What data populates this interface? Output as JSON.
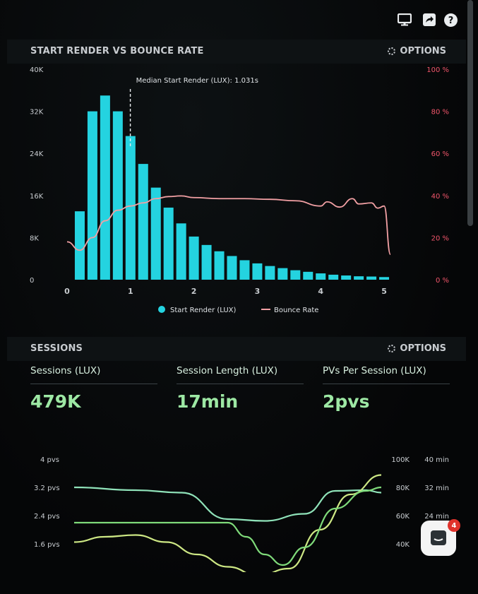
{
  "toolbar": {
    "icons": [
      "monitor-icon",
      "share-icon",
      "help-icon"
    ],
    "help_label": "?"
  },
  "chart1": {
    "title": "START RENDER VS BOUNCE RATE",
    "options_label": "OPTIONS",
    "annotation": "Median Start Render (LUX): 1.031s",
    "legend": [
      "Start Render (LUX)",
      "Bounce Rate"
    ]
  },
  "sessions": {
    "title": "SESSIONS",
    "options_label": "OPTIONS",
    "metrics": [
      {
        "label": "Sessions (LUX)",
        "value": "479K"
      },
      {
        "label": "Session Length (LUX)",
        "value": "17min"
      },
      {
        "label": "PVs Per Session (LUX)",
        "value": "2pvs"
      }
    ]
  },
  "chat": {
    "badge": "4"
  },
  "colors": {
    "bar": "#24d3e0",
    "bounce_line": "#f2a0a4",
    "pvs_line": "#8fe2b9",
    "sessions_line": "#cde784",
    "length_line": "#7fda7a",
    "right_axis_text": "#f0556a",
    "metric_value": "#9de8a4"
  },
  "chart_data": [
    {
      "type": "bar",
      "title": "START RENDER VS BOUNCE RATE",
      "x": [
        0.2,
        0.4,
        0.6,
        0.8,
        1.0,
        1.2,
        1.4,
        1.6,
        1.8,
        2.0,
        2.2,
        2.4,
        2.6,
        2.8,
        3.0,
        3.2,
        3.4,
        3.6,
        3.8,
        4.0,
        4.2,
        4.4,
        4.6,
        4.8,
        5.0
      ],
      "series": [
        {
          "name": "Start Render (LUX)",
          "axis": "left",
          "values": [
            13000,
            32000,
            35000,
            32000,
            27300,
            22000,
            17500,
            13700,
            10700,
            8200,
            6600,
            5400,
            4500,
            3700,
            3100,
            2600,
            2200,
            1800,
            1500,
            1200,
            950,
            800,
            650,
            600,
            500
          ]
        },
        {
          "name": "Bounce Rate",
          "type": "line",
          "axis": "right",
          "x": [
            0.0,
            0.2,
            0.4,
            0.6,
            0.8,
            1.0,
            1.2,
            1.4,
            1.6,
            1.8,
            2.0,
            2.4,
            2.8,
            3.2,
            3.6,
            4.0,
            4.1,
            4.3,
            4.5,
            4.6,
            4.8,
            4.9,
            5.0,
            5.1
          ],
          "values": [
            18,
            14,
            20,
            28,
            33,
            35,
            36.5,
            38.5,
            39.5,
            39.8,
            39,
            38.5,
            38.5,
            38.2,
            37.5,
            35,
            37,
            34.5,
            38.5,
            36,
            36.5,
            34,
            35,
            12
          ]
        }
      ],
      "ylim_left": [
        0,
        40000
      ],
      "ylim_right": [
        0,
        100
      ],
      "xlim": [
        0,
        5.2
      ],
      "x_ticks": [
        "0",
        "1",
        "2",
        "3",
        "4",
        "5"
      ],
      "y_ticks_left": [
        "0",
        "8K",
        "16K",
        "24K",
        "32K",
        "40K"
      ],
      "y_ticks_right": [
        "0 %",
        "20 %",
        "40 %",
        "60 %",
        "80 %",
        "100 %"
      ],
      "median_marker_x": 1.031,
      "legend": [
        "Start Render (LUX)",
        "Bounce Rate"
      ],
      "grid": false
    },
    {
      "type": "line",
      "title": "SESSIONS",
      "y_ticks_left": [
        "1.6 pvs",
        "2.4 pvs",
        "3.2 pvs",
        "4 pvs"
      ],
      "y_ticks_right_1": [
        "40K",
        "60K",
        "80K",
        "100K"
      ],
      "y_ticks_right_2": [
        "40 min",
        "32 min",
        "24 min"
      ],
      "series": [
        {
          "name": "PVs Per Session (LUX)",
          "t": [
            0,
            0.2,
            0.35,
            0.5,
            0.62,
            0.75,
            0.85,
            0.95,
            1.0
          ],
          "values": [
            3.2,
            3.12,
            3.05,
            2.3,
            2.25,
            2.45,
            3.1,
            3.12,
            3.05
          ]
        },
        {
          "name": "Sessions (LUX)",
          "t": [
            0,
            0.1,
            0.2,
            0.3,
            0.4,
            0.5,
            0.6,
            0.7,
            0.8,
            0.9,
            1.0
          ],
          "values": [
            1.65,
            1.8,
            1.85,
            1.65,
            1.3,
            0.95,
            0.7,
            0.9,
            2.0,
            3.0,
            3.55
          ]
        },
        {
          "name": "Session Length (LUX)",
          "t": [
            0,
            0.5,
            0.56,
            0.62,
            0.68,
            0.75,
            0.85,
            0.95,
            1.0
          ],
          "values": [
            2.2,
            2.2,
            1.8,
            1.3,
            1.0,
            1.5,
            2.6,
            3.1,
            3.2
          ]
        }
      ]
    }
  ]
}
